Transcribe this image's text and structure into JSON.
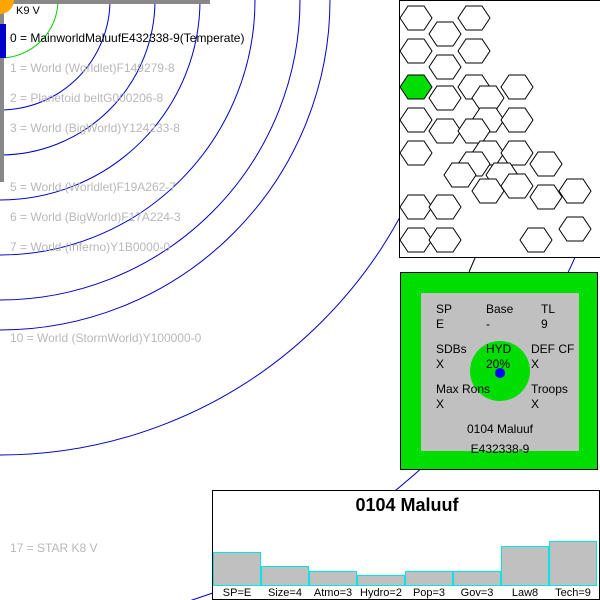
{
  "star": {
    "label": "K9 V"
  },
  "orbits": [
    {
      "label": "0 = MainworldMaluufE432338-9(Temperate)",
      "main": true
    },
    {
      "label": "1 = World  (Worldlet)F149279-8"
    },
    {
      "label": "2 = Planetoid beltG000206-8"
    },
    {
      "label": "3 = World  (BigWorld)Y124233-8"
    },
    {
      "label": "5 = World  (Worldlet)F19A262-7"
    },
    {
      "label": "6 = World  (BigWorld)F17A224-3"
    },
    {
      "label": "7 = World  (Inferno)Y1B0000-0"
    },
    {
      "label": "10 = World  (StormWorld)Y100000-0"
    },
    {
      "label": "17 = STAR K8 V"
    }
  ],
  "planet_card": {
    "sp_label": "SP",
    "sp_value": "E",
    "base_label": "Base",
    "base_value": "-",
    "tl_label": "TL",
    "tl_value": "9",
    "sdbs_label": "SDBs",
    "sdbs_value": "X",
    "hyd_label": "HYD",
    "hyd_value": "20%",
    "def_label": "DEF CF",
    "def_value": "X",
    "maxrons_label": "Max Rons",
    "maxrons_value": "X",
    "troops_label": "Troops",
    "troops_value": "X",
    "name": "0104 Maluuf",
    "uwp": "E432338-9"
  },
  "bottom_panel": {
    "title": "0104 Maluuf",
    "stats": [
      {
        "label": "SP=E",
        "level": 0.55
      },
      {
        "label": "Size=4",
        "level": 0.32
      },
      {
        "label": "Atmo=3",
        "level": 0.24
      },
      {
        "label": "Hydro=2",
        "level": 0.17
      },
      {
        "label": "Pop=3",
        "level": 0.24
      },
      {
        "label": "Gov=3",
        "level": 0.24
      },
      {
        "label": "Law8",
        "level": 0.64
      },
      {
        "label": "Tech=9",
        "level": 0.72
      }
    ]
  },
  "colors": {
    "orbit": "#0000cc",
    "habitable_orbit": "#00cc00",
    "hex_highlight": "#00dd00",
    "card_green": "#00dd00",
    "panel_grey": "#c0c0c0",
    "bar_border": "#00e5e5",
    "star_yellow": "#ffa500"
  }
}
